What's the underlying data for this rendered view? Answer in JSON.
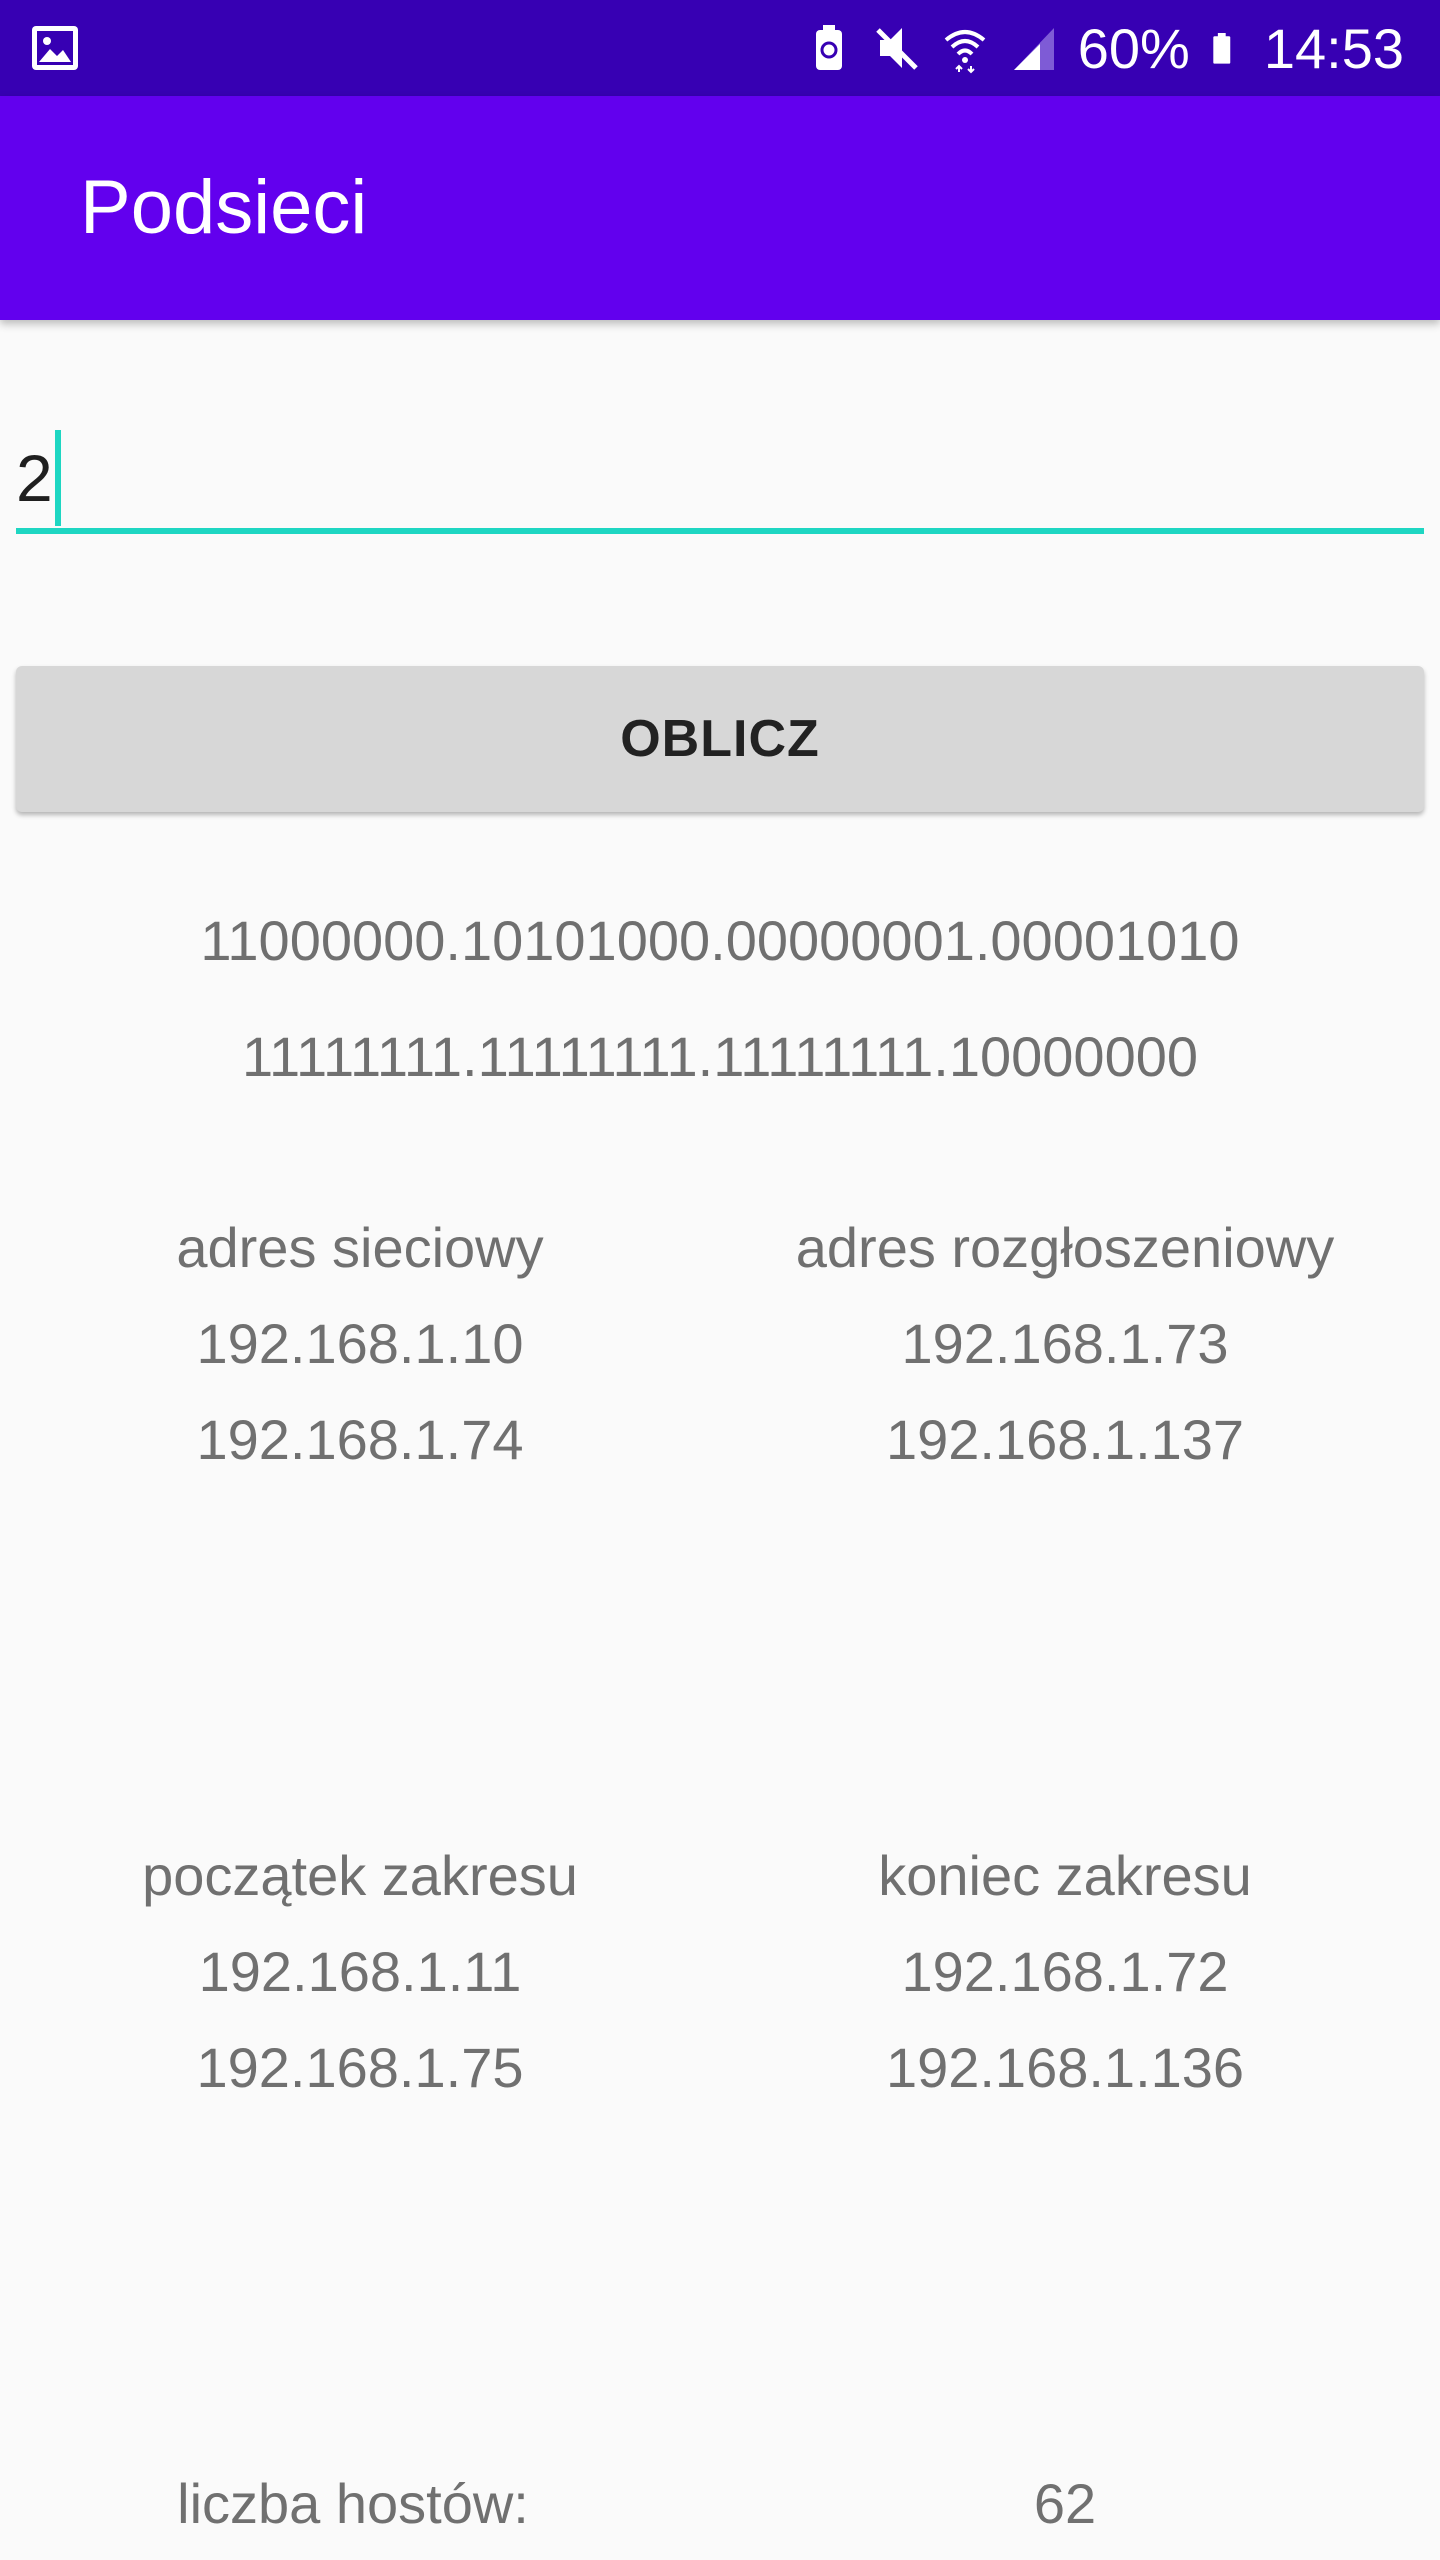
{
  "status_bar": {
    "battery_percent": "60%",
    "time": "14:53",
    "icons": [
      "image-icon",
      "battery-saver-icon",
      "mute-icon",
      "wifi-icon",
      "signal-icon",
      "battery-icon"
    ]
  },
  "app_bar": {
    "title": "Podsieci"
  },
  "input": {
    "value": "2"
  },
  "button": {
    "label": "OBLICZ"
  },
  "binary": {
    "address": "11000000.10101000.00000001.00001010",
    "mask": "11111111.11111111.11111111.10000000"
  },
  "network": {
    "left_header": "adres sieciowy",
    "right_header": "adres rozgłoszeniowy",
    "left_values": [
      "192.168.1.10",
      "192.168.1.74"
    ],
    "right_values": [
      "192.168.1.73",
      "192.168.1.137"
    ]
  },
  "range": {
    "left_header": "początek zakresu",
    "right_header": "koniec zakresu",
    "left_values": [
      "192.168.1.11",
      "192.168.1.75"
    ],
    "right_values": [
      "192.168.1.72",
      "192.168.1.136"
    ]
  },
  "hosts": {
    "label": "liczba hostów:",
    "value": "62"
  },
  "colors": {
    "status_bar": "#3700b3",
    "app_bar": "#6200ee",
    "accent": "#1ed6c2",
    "button": "#d7d7d7"
  }
}
